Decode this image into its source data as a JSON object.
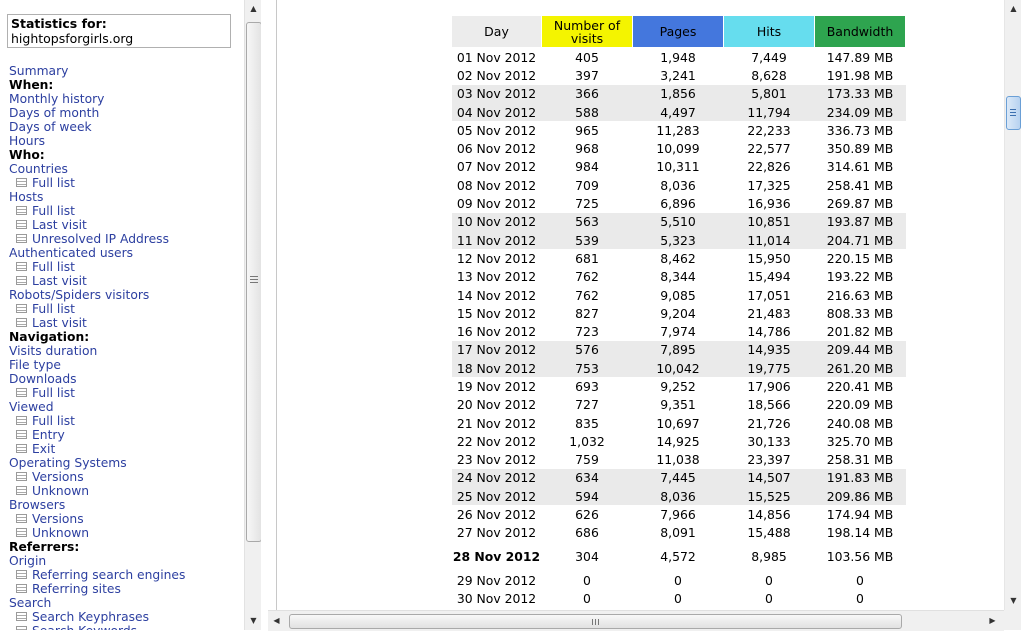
{
  "sidebar": {
    "stats_label": "Statistics for:",
    "site": "hightopsforgirls.org",
    "menu": [
      {
        "t": "link",
        "label": "Summary"
      },
      {
        "t": "head",
        "label": "When:"
      },
      {
        "t": "link",
        "label": "Monthly history"
      },
      {
        "t": "link",
        "label": "Days of month"
      },
      {
        "t": "link",
        "label": "Days of week"
      },
      {
        "t": "link",
        "label": "Hours"
      },
      {
        "t": "head",
        "label": "Who:"
      },
      {
        "t": "link",
        "label": "Countries"
      },
      {
        "t": "sub",
        "label": "Full list"
      },
      {
        "t": "link",
        "label": "Hosts"
      },
      {
        "t": "sub",
        "label": "Full list"
      },
      {
        "t": "sub",
        "label": "Last visit"
      },
      {
        "t": "sub",
        "label": "Unresolved IP Address"
      },
      {
        "t": "link",
        "label": "Authenticated users"
      },
      {
        "t": "sub",
        "label": "Full list"
      },
      {
        "t": "sub",
        "label": "Last visit"
      },
      {
        "t": "link",
        "label": "Robots/Spiders visitors"
      },
      {
        "t": "sub",
        "label": "Full list"
      },
      {
        "t": "sub",
        "label": "Last visit"
      },
      {
        "t": "head",
        "label": "Navigation:"
      },
      {
        "t": "link",
        "label": "Visits duration"
      },
      {
        "t": "link",
        "label": "File type"
      },
      {
        "t": "link",
        "label": "Downloads"
      },
      {
        "t": "sub",
        "label": "Full list"
      },
      {
        "t": "link",
        "label": "Viewed"
      },
      {
        "t": "sub",
        "label": "Full list"
      },
      {
        "t": "sub",
        "label": "Entry"
      },
      {
        "t": "sub",
        "label": "Exit"
      },
      {
        "t": "link",
        "label": "Operating Systems"
      },
      {
        "t": "sub",
        "label": "Versions"
      },
      {
        "t": "sub",
        "label": "Unknown"
      },
      {
        "t": "link",
        "label": "Browsers"
      },
      {
        "t": "sub",
        "label": "Versions"
      },
      {
        "t": "sub",
        "label": "Unknown"
      },
      {
        "t": "head",
        "label": "Referrers:"
      },
      {
        "t": "link",
        "label": "Origin"
      },
      {
        "t": "sub",
        "label": "Referring search engines"
      },
      {
        "t": "sub",
        "label": "Referring sites"
      },
      {
        "t": "link",
        "label": "Search"
      },
      {
        "t": "sub",
        "label": "Search Keyphrases"
      },
      {
        "t": "sub",
        "label": "Search Keywords"
      }
    ]
  },
  "table": {
    "headers": {
      "day": "Day",
      "visits": "Number of visits",
      "pages": "Pages",
      "hits": "Hits",
      "bandwidth": "Bandwidth"
    },
    "header_colors": {
      "day": "#ececec",
      "visits": "#f4f400",
      "pages": "#4477dd",
      "hits": "#66ddee",
      "bandwidth": "#2ea44f"
    },
    "rows": [
      {
        "day": "01 Nov 2012",
        "visits": "405",
        "pages": "1,948",
        "hits": "7,449",
        "bandwidth": "147.89 MB",
        "weekend": false
      },
      {
        "day": "02 Nov 2012",
        "visits": "397",
        "pages": "3,241",
        "hits": "8,628",
        "bandwidth": "191.98 MB",
        "weekend": false
      },
      {
        "day": "03 Nov 2012",
        "visits": "366",
        "pages": "1,856",
        "hits": "5,801",
        "bandwidth": "173.33 MB",
        "weekend": true
      },
      {
        "day": "04 Nov 2012",
        "visits": "588",
        "pages": "4,497",
        "hits": "11,794",
        "bandwidth": "234.09 MB",
        "weekend": true
      },
      {
        "day": "05 Nov 2012",
        "visits": "965",
        "pages": "11,283",
        "hits": "22,233",
        "bandwidth": "336.73 MB",
        "weekend": false
      },
      {
        "day": "06 Nov 2012",
        "visits": "968",
        "pages": "10,099",
        "hits": "22,577",
        "bandwidth": "350.89 MB",
        "weekend": false
      },
      {
        "day": "07 Nov 2012",
        "visits": "984",
        "pages": "10,311",
        "hits": "22,826",
        "bandwidth": "314.61 MB",
        "weekend": false
      },
      {
        "day": "08 Nov 2012",
        "visits": "709",
        "pages": "8,036",
        "hits": "17,325",
        "bandwidth": "258.41 MB",
        "weekend": false
      },
      {
        "day": "09 Nov 2012",
        "visits": "725",
        "pages": "6,896",
        "hits": "16,936",
        "bandwidth": "269.87 MB",
        "weekend": false
      },
      {
        "day": "10 Nov 2012",
        "visits": "563",
        "pages": "5,510",
        "hits": "10,851",
        "bandwidth": "193.87 MB",
        "weekend": true
      },
      {
        "day": "11 Nov 2012",
        "visits": "539",
        "pages": "5,323",
        "hits": "11,014",
        "bandwidth": "204.71 MB",
        "weekend": true
      },
      {
        "day": "12 Nov 2012",
        "visits": "681",
        "pages": "8,462",
        "hits": "15,950",
        "bandwidth": "220.15 MB",
        "weekend": false
      },
      {
        "day": "13 Nov 2012",
        "visits": "762",
        "pages": "8,344",
        "hits": "15,494",
        "bandwidth": "193.22 MB",
        "weekend": false
      },
      {
        "day": "14 Nov 2012",
        "visits": "762",
        "pages": "9,085",
        "hits": "17,051",
        "bandwidth": "216.63 MB",
        "weekend": false
      },
      {
        "day": "15 Nov 2012",
        "visits": "827",
        "pages": "9,204",
        "hits": "21,483",
        "bandwidth": "808.33 MB",
        "weekend": false
      },
      {
        "day": "16 Nov 2012",
        "visits": "723",
        "pages": "7,974",
        "hits": "14,786",
        "bandwidth": "201.82 MB",
        "weekend": false
      },
      {
        "day": "17 Nov 2012",
        "visits": "576",
        "pages": "7,895",
        "hits": "14,935",
        "bandwidth": "209.44 MB",
        "weekend": true
      },
      {
        "day": "18 Nov 2012",
        "visits": "753",
        "pages": "10,042",
        "hits": "19,775",
        "bandwidth": "261.20 MB",
        "weekend": true
      },
      {
        "day": "19 Nov 2012",
        "visits": "693",
        "pages": "9,252",
        "hits": "17,906",
        "bandwidth": "220.41 MB",
        "weekend": false
      },
      {
        "day": "20 Nov 2012",
        "visits": "727",
        "pages": "9,351",
        "hits": "18,566",
        "bandwidth": "220.09 MB",
        "weekend": false
      },
      {
        "day": "21 Nov 2012",
        "visits": "835",
        "pages": "10,697",
        "hits": "21,726",
        "bandwidth": "240.08 MB",
        "weekend": false
      },
      {
        "day": "22 Nov 2012",
        "visits": "1,032",
        "pages": "14,925",
        "hits": "30,133",
        "bandwidth": "325.70 MB",
        "weekend": false
      },
      {
        "day": "23 Nov 2012",
        "visits": "759",
        "pages": "11,038",
        "hits": "23,397",
        "bandwidth": "258.31 MB",
        "weekend": false
      },
      {
        "day": "24 Nov 2012",
        "visits": "634",
        "pages": "7,445",
        "hits": "14,507",
        "bandwidth": "191.83 MB",
        "weekend": true
      },
      {
        "day": "25 Nov 2012",
        "visits": "594",
        "pages": "8,036",
        "hits": "15,525",
        "bandwidth": "209.86 MB",
        "weekend": true
      },
      {
        "day": "26 Nov 2012",
        "visits": "626",
        "pages": "7,966",
        "hits": "14,856",
        "bandwidth": "174.94 MB",
        "weekend": false
      },
      {
        "day": "27 Nov 2012",
        "visits": "686",
        "pages": "8,091",
        "hits": "15,488",
        "bandwidth": "198.14 MB",
        "weekend": false
      },
      {
        "day": "28 Nov 2012",
        "visits": "304",
        "pages": "4,572",
        "hits": "8,985",
        "bandwidth": "103.56 MB",
        "weekend": false,
        "today": true
      },
      {
        "day": "29 Nov 2012",
        "visits": "0",
        "pages": "0",
        "hits": "0",
        "bandwidth": "0",
        "weekend": false
      },
      {
        "day": "30 Nov 2012",
        "visits": "0",
        "pages": "0",
        "hits": "0",
        "bandwidth": "0",
        "weekend": false
      }
    ]
  },
  "scrollbars": {
    "left_up": "▲",
    "left_down": "▼",
    "right_up": "▲",
    "right_down": "▼",
    "h_left": "◀",
    "h_right": "▶"
  }
}
